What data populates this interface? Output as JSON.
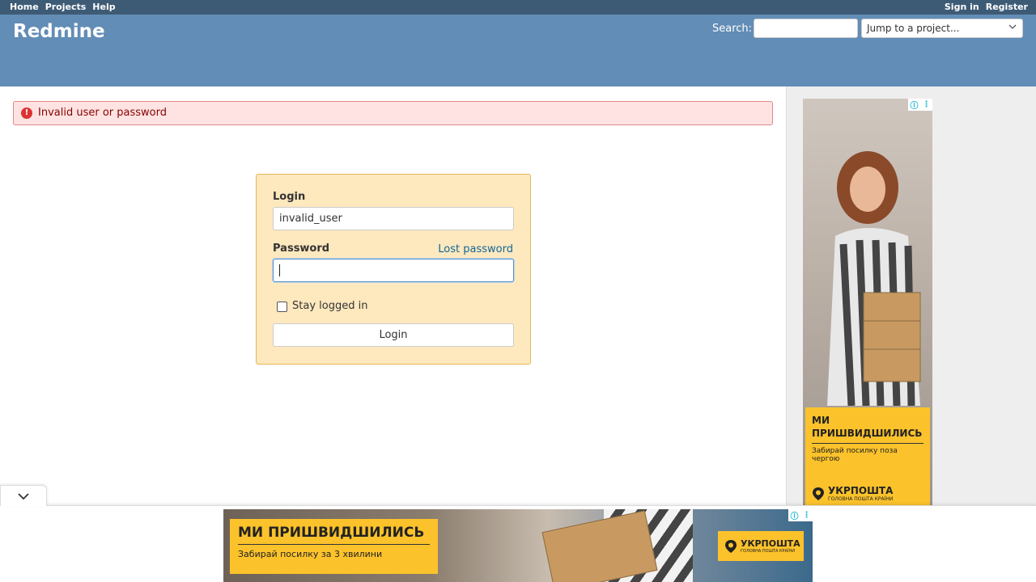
{
  "top_menu": {
    "left": [
      "Home",
      "Projects",
      "Help"
    ],
    "right": [
      "Sign in",
      "Register"
    ]
  },
  "header": {
    "title": "Redmine",
    "search_label": "Search:",
    "search_value": "",
    "jump_label": "Jump to a project..."
  },
  "flash": {
    "message": "Invalid user or password"
  },
  "login": {
    "login_label": "Login",
    "login_value": "invalid_user",
    "password_label": "Password",
    "lost_password": "Lost password",
    "password_value": "",
    "stay_logged_in": "Stay logged in",
    "stay_logged_in_checked": false,
    "submit": "Login"
  },
  "side_ad": {
    "headline": "МИ ПРИШВИДШИЛИСЬ",
    "subline": "Забирай посилку поза чергою",
    "brand": "УКРПОШТА",
    "brand_tagline": "ГОЛОВНА ПОШТА КРАЇНИ",
    "badges": [
      "ⓘ",
      "⋮"
    ]
  },
  "bottom_ad": {
    "headline": "МИ ПРИШВИДШИЛИСЬ",
    "subline": "Забирай посилку за 3 хвилини",
    "brand": "УКРПОШТА",
    "brand_tagline": "ГОЛОВНА ПОШТА КРАЇНИ",
    "badges": [
      "ⓘ",
      "⋮"
    ]
  },
  "colors": {
    "top_menu_bg": "#3e5b76",
    "header_bg": "#628db6",
    "flash_bg": "#ffe3e3",
    "login_box_bg": "#fee8be",
    "link": "#169",
    "ad_yellow": "#fbc22b"
  },
  "icons": {
    "error": "error-circle-icon",
    "select_chevron": "chevron-down-icon",
    "collapse": "chevron-down-icon",
    "ad_info": "info-icon",
    "ad_menu": "kebab-menu-icon",
    "brand_logo": "location-pin-icon"
  }
}
